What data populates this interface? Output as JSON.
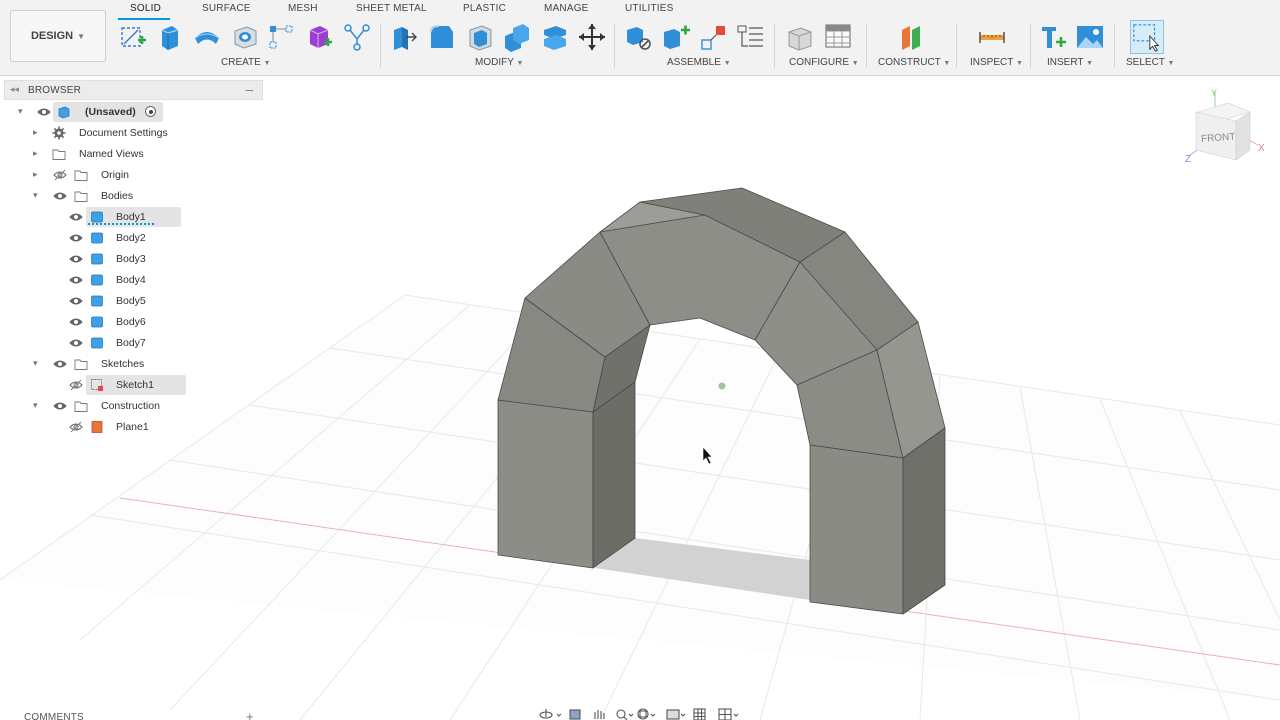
{
  "toolbar": {
    "design_button": "DESIGN",
    "tabs": [
      "SOLID",
      "SURFACE",
      "MESH",
      "SHEET METAL",
      "PLASTIC",
      "MANAGE",
      "UTILITIES"
    ],
    "groups": [
      "CREATE",
      "MODIFY",
      "ASSEMBLE",
      "CONFIGURE",
      "CONSTRUCT",
      "INSPECT",
      "INSERT",
      "SELECT"
    ],
    "active_tab": "SOLID",
    "accent_color": "#0696d7"
  },
  "browser": {
    "title": "BROWSER",
    "items": [
      {
        "label": "(Unsaved)",
        "icon": "component-icon"
      },
      {
        "label": "Document Settings",
        "icon": "gear-icon"
      },
      {
        "label": "Named Views",
        "icon": "folder-icon"
      },
      {
        "label": "Origin",
        "icon": "folder-icon"
      },
      {
        "label": "Bodies",
        "icon": "folder-icon"
      },
      {
        "label": "Body1",
        "icon": "body-icon"
      },
      {
        "label": "Body2",
        "icon": "body-icon"
      },
      {
        "label": "Body3",
        "icon": "body-icon"
      },
      {
        "label": "Body4",
        "icon": "body-icon"
      },
      {
        "label": "Body5",
        "icon": "body-icon"
      },
      {
        "label": "Body6",
        "icon": "body-icon"
      },
      {
        "label": "Body7",
        "icon": "body-icon"
      },
      {
        "label": "Sketches",
        "icon": "folder-icon"
      },
      {
        "label": "Sketch1",
        "icon": "sketch-icon"
      },
      {
        "label": "Construction",
        "icon": "folder-icon"
      },
      {
        "label": "Plane1",
        "icon": "plane-icon"
      }
    ]
  },
  "viewcube": {
    "face": "FRONT",
    "axis_y": "Y",
    "axis_x": "X",
    "axis_z": "Z"
  },
  "comments": {
    "label": "COMMENTS"
  },
  "colors": {
    "body_fill": "#8a8b84",
    "body_dark": "#6e6f69",
    "body_light": "#9a9b94",
    "accent": "#0696d7"
  }
}
